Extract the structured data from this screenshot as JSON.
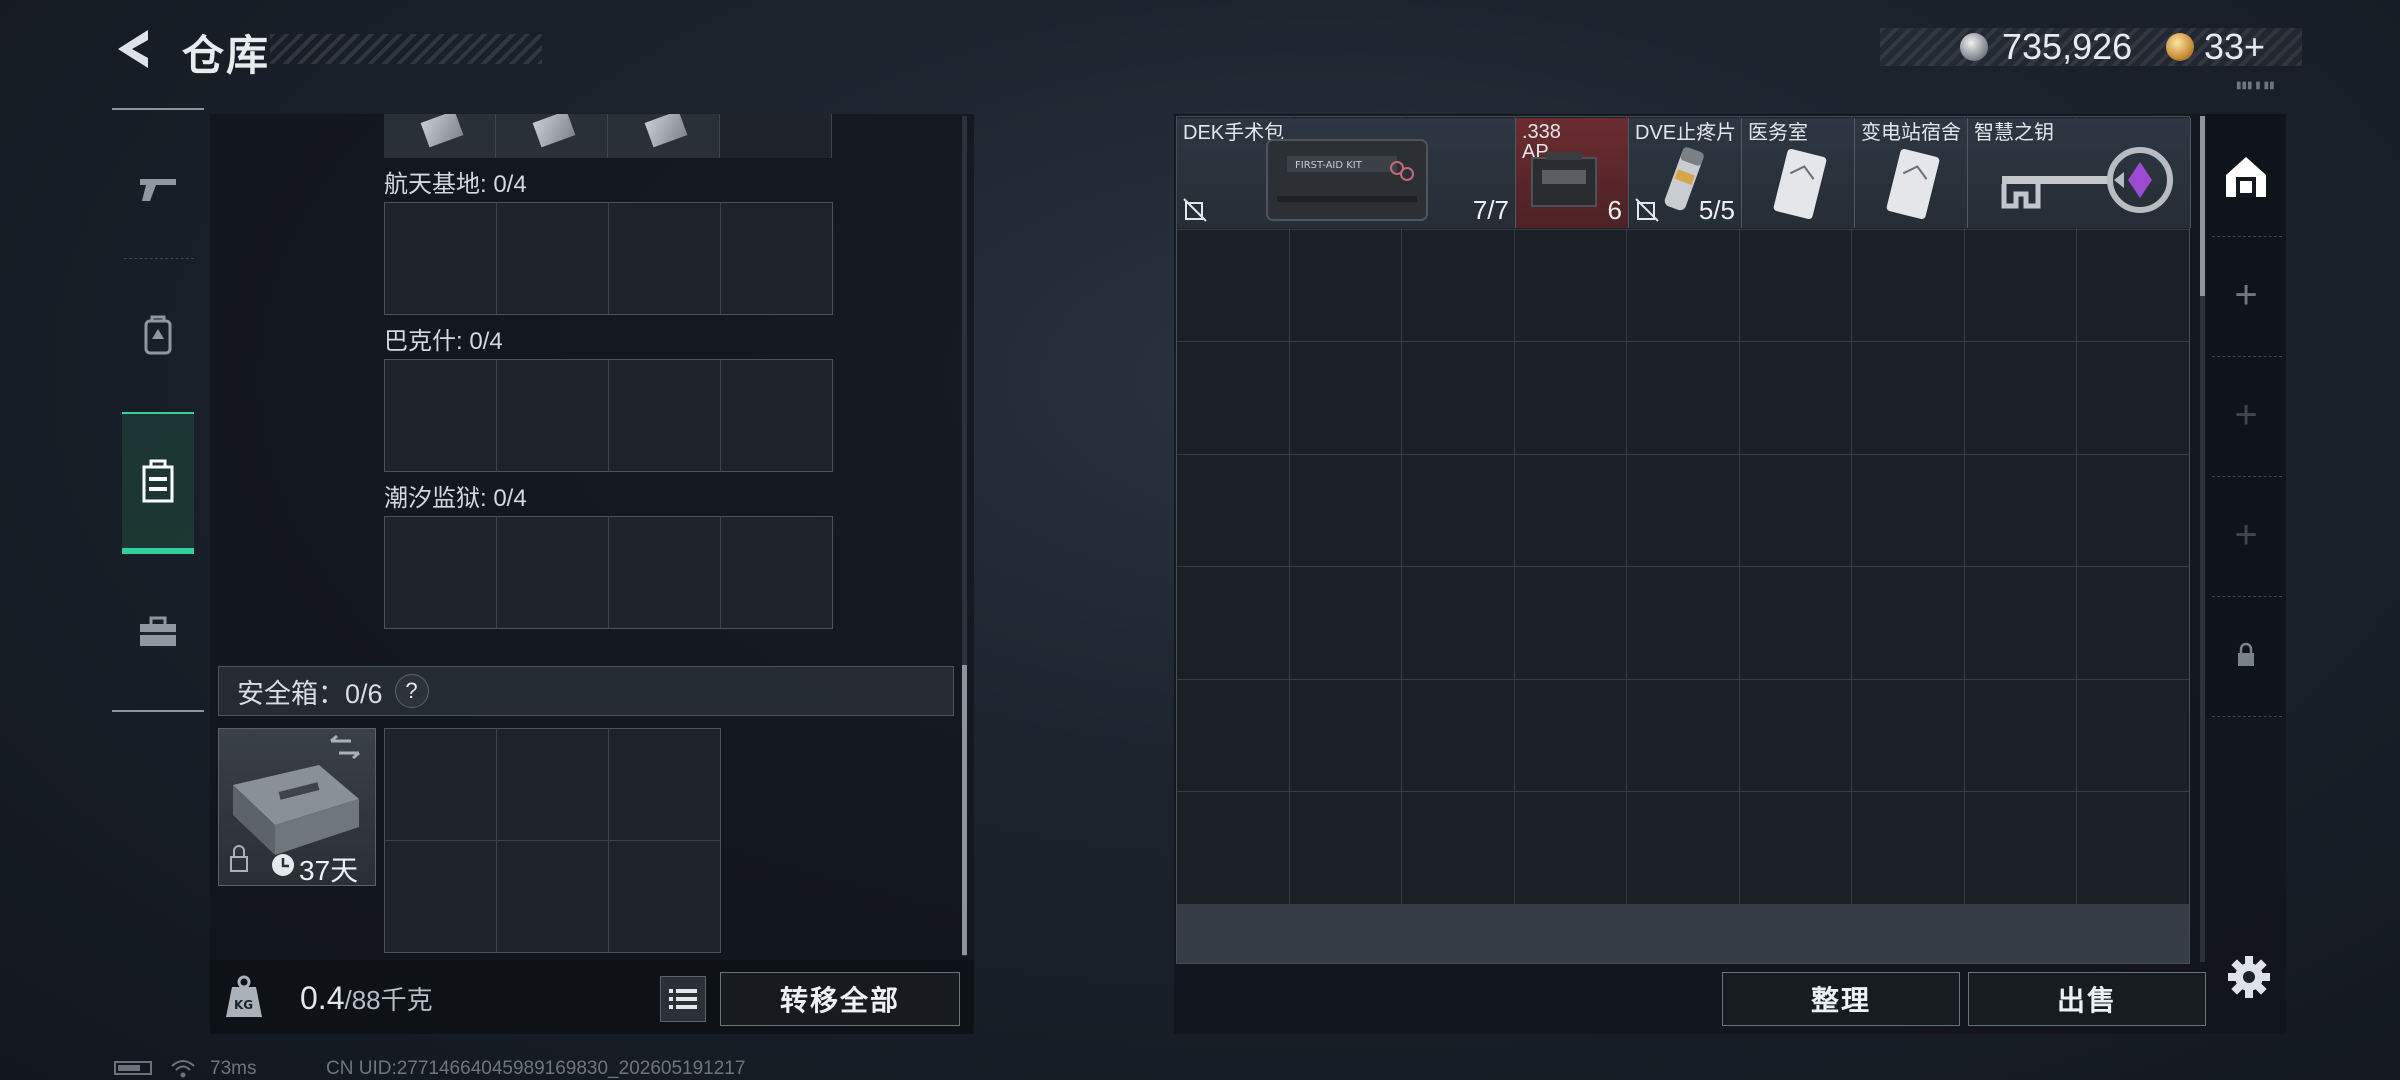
{
  "header": {
    "title": "仓库",
    "silver": "735,926",
    "gold": "33",
    "gold_add": "+",
    "tiny_tag": "▮▮▮ ▮ ▮▮"
  },
  "left_nav": {
    "items": [
      "gun-icon",
      "backpack-icon",
      "container-icon",
      "toolbox-icon"
    ],
    "active": "container-icon"
  },
  "key_sections": [
    {
      "label": "航天基地: 0/4"
    },
    {
      "label": "巴克什: 0/4"
    },
    {
      "label": "潮汐监狱: 0/4"
    }
  ],
  "safe_box": {
    "label": "安全箱：0/6",
    "help": "?",
    "duration": "37天"
  },
  "weight": {
    "current": "0.4",
    "max": "/88千克"
  },
  "buttons": {
    "transfer_all": "转移全部",
    "sort": "整理",
    "sell": "出售"
  },
  "status": {
    "ping": "73ms",
    "uid": "CN UID:27714664045989169830_202605191217"
  },
  "stash_items": [
    {
      "name": "DEK手术包",
      "count": "7/7"
    },
    {
      "name": ".338\nAP",
      "count": "6"
    },
    {
      "name": "DVE止疼片",
      "count": "5/5"
    },
    {
      "name": "医务室",
      "count": ""
    },
    {
      "name": "变电站宿舍",
      "count": ""
    },
    {
      "name": "智慧之钥",
      "count": ""
    }
  ],
  "right_tabs": [
    "stash-icon",
    "+",
    "+",
    "+",
    "lock-icon"
  ],
  "colors": {
    "accent_green": "#33d19a",
    "ammo_red": "#5a2a2e"
  }
}
